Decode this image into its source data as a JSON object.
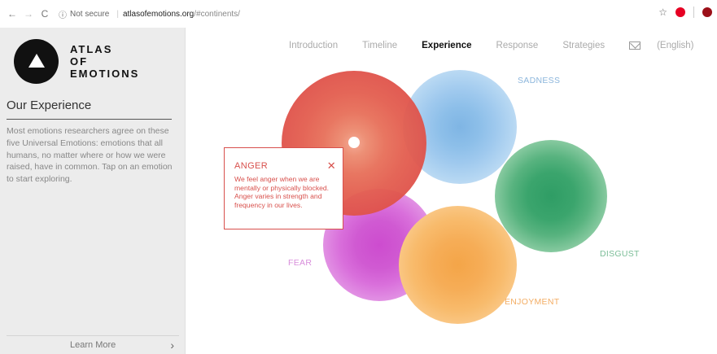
{
  "browser": {
    "security_label": "Not secure",
    "host": "atlasofemotions.org",
    "path": "/#continents/"
  },
  "sidebar": {
    "logo_lines": [
      "ATLAS",
      "OF",
      "EMOTIONS"
    ],
    "title": "Our Experience",
    "description": "Most emotions researchers agree on these five Universal Emotions: emotions that all humans, no matter where or how we were raised, have in common. Tap on an emotion to start exploring.",
    "learn_more": "Learn More"
  },
  "nav": {
    "introduction": "Introduction",
    "timeline": "Timeline",
    "experience": "Experience",
    "response": "Response",
    "strategies": "Strategies",
    "language": "(English)",
    "active": "Experience"
  },
  "emotions": {
    "anger": {
      "label": "ANGER",
      "color": "#d8504c"
    },
    "sadness": {
      "label": "SADNESS",
      "color": "#8cb6dc"
    },
    "disgust": {
      "label": "DISGUST",
      "color": "#2f9d65"
    },
    "fear": {
      "label": "FEAR",
      "color": "#cd4ccf"
    },
    "enjoyment": {
      "label": "ENJOYMENT",
      "color": "#f4a548"
    }
  },
  "tooltip": {
    "title": "ANGER",
    "close_icon": "close-icon",
    "body": "We feel anger when we are mentally or physically blocked. Anger varies in strength and frequency in our lives."
  },
  "icons": {
    "back": "back-arrow-icon",
    "forward": "forward-arrow-icon",
    "reload": "reload-icon",
    "info": "info-icon",
    "bookmark": "star-icon",
    "pinterest": "pinterest-icon",
    "extension": "extension-icon",
    "mail": "mail-icon",
    "chevron": "chevron-right-icon"
  }
}
